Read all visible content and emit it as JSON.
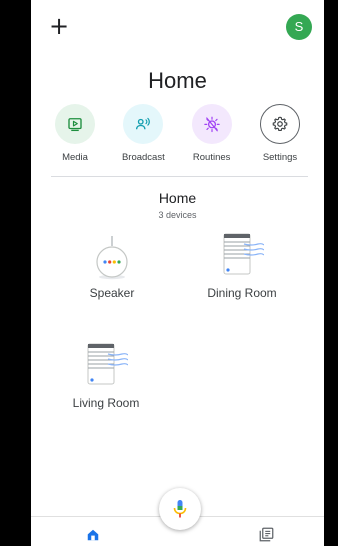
{
  "header": {
    "add_symbol": "+",
    "avatar_initial": "S"
  },
  "title": "Home",
  "actions": [
    {
      "label": "Media",
      "icon": "play-box-icon",
      "bg": "#e6f4ea",
      "fg": "#1e8e3e"
    },
    {
      "label": "Broadcast",
      "icon": "broadcast-icon",
      "bg": "#e4f7fb",
      "fg": "#129eaf"
    },
    {
      "label": "Routines",
      "icon": "routines-icon",
      "bg": "#f3e8fd",
      "fg": "#a142f4"
    },
    {
      "label": "Settings",
      "icon": "gear-icon",
      "bg": "#ffffff",
      "fg": "#3c4043"
    }
  ],
  "room": {
    "title": "Home",
    "subtitle": "3 devices"
  },
  "devices": [
    {
      "label": "Speaker",
      "icon": "smart-speaker-icon"
    },
    {
      "label": "Dining Room",
      "icon": "speaker-group-icon"
    },
    {
      "label": "Living Room",
      "icon": "speaker-group-icon"
    }
  ],
  "bottom_nav": {
    "home_icon": "home-icon",
    "feed_icon": "feed-icon",
    "mic_icon": "mic-icon"
  },
  "colors": {
    "avatar": "#34a853",
    "home_active": "#1a73e8"
  }
}
